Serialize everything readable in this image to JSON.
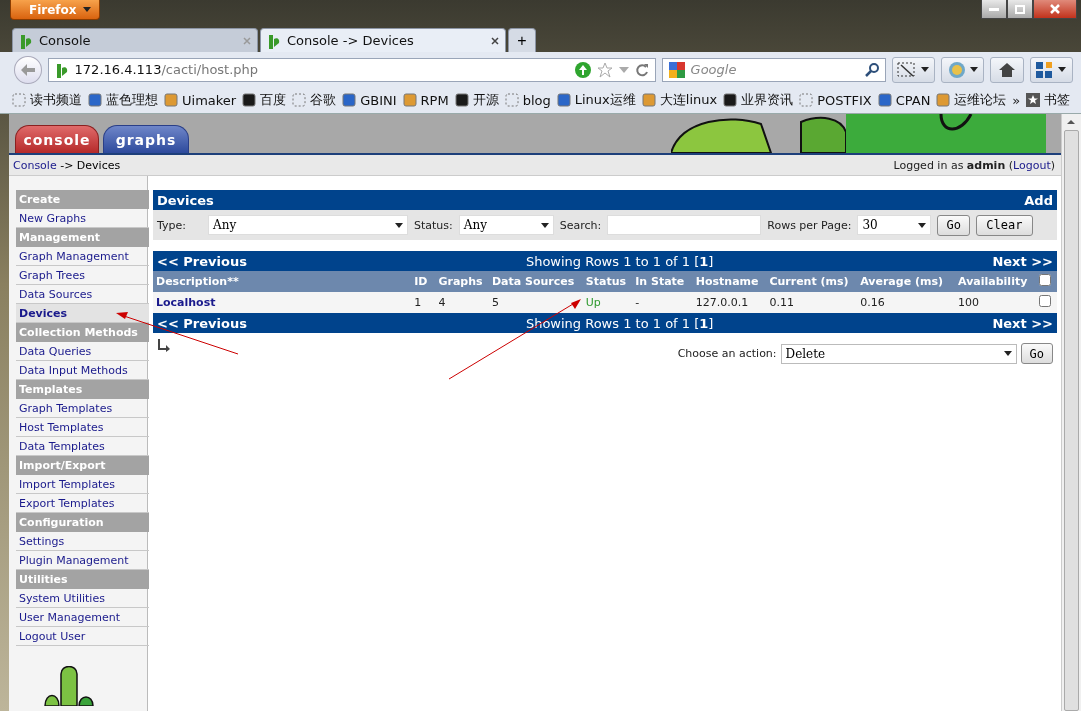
{
  "browser": {
    "menu_button": "Firefox",
    "tabs": [
      {
        "title": "Console",
        "selected": false
      },
      {
        "title": "Console -> Devices",
        "selected": true
      }
    ],
    "new_tab": "+",
    "url": {
      "host": "172.16.4.113",
      "path": "/cacti/host.php"
    },
    "search": {
      "placeholder": "Google"
    },
    "bookmarks": [
      "读书频道",
      "蓝色理想",
      "Uimaker",
      "百度",
      "谷歌",
      "GBINI",
      "RPM",
      "开源",
      "blog",
      "Linux运维",
      "大连linux",
      "业界资讯",
      "POSTFIX",
      "CPAN",
      "运维论坛"
    ],
    "bookmarks_more": "»",
    "bookmarks_folder": "书签"
  },
  "cacti": {
    "top_tabs": [
      {
        "label": "console",
        "selected": true
      },
      {
        "label": "graphs",
        "selected": false
      }
    ],
    "breadcrumb": {
      "link": "Console",
      "rest": "-> Devices"
    },
    "login": {
      "prefix": "Logged in as",
      "user": "admin",
      "open": "(",
      "link": "Logout",
      "close": ")"
    },
    "sidebar": [
      {
        "kind": "header",
        "label": "Create"
      },
      {
        "kind": "item",
        "label": "New Graphs",
        "selected": false
      },
      {
        "kind": "header",
        "label": "Management"
      },
      {
        "kind": "item",
        "label": "Graph Management",
        "selected": false
      },
      {
        "kind": "item",
        "label": "Graph Trees",
        "selected": false
      },
      {
        "kind": "item",
        "label": "Data Sources",
        "selected": false
      },
      {
        "kind": "item",
        "label": "Devices",
        "selected": true
      },
      {
        "kind": "header",
        "label": "Collection Methods"
      },
      {
        "kind": "item",
        "label": "Data Queries",
        "selected": false
      },
      {
        "kind": "item",
        "label": "Data Input Methods",
        "selected": false
      },
      {
        "kind": "header",
        "label": "Templates"
      },
      {
        "kind": "item",
        "label": "Graph Templates",
        "selected": false
      },
      {
        "kind": "item",
        "label": "Host Templates",
        "selected": false
      },
      {
        "kind": "item",
        "label": "Data Templates",
        "selected": false
      },
      {
        "kind": "header",
        "label": "Import/Export"
      },
      {
        "kind": "item",
        "label": "Import Templates",
        "selected": false
      },
      {
        "kind": "item",
        "label": "Export Templates",
        "selected": false
      },
      {
        "kind": "header",
        "label": "Configuration"
      },
      {
        "kind": "item",
        "label": "Settings",
        "selected": false
      },
      {
        "kind": "item",
        "label": "Plugin Management",
        "selected": false
      },
      {
        "kind": "header",
        "label": "Utilities"
      },
      {
        "kind": "item",
        "label": "System Utilities",
        "selected": false
      },
      {
        "kind": "item",
        "label": "User Management",
        "selected": false
      },
      {
        "kind": "item",
        "label": "Logout User",
        "selected": false
      }
    ],
    "devices": {
      "title": "Devices",
      "add": "Add",
      "filters": {
        "type_label": "Type:",
        "type_value": "Any",
        "status_label": "Status:",
        "status_value": "Any",
        "search_label": "Search:",
        "rows_label": "Rows per Page:",
        "rows_value": "30",
        "go": "Go",
        "clear": "Clear"
      },
      "pagers": [
        {
          "previous": "<< Previous",
          "showing": "Showing Rows 1 to 1 of 1 [**1**]",
          "next": "Next >>"
        },
        {
          "previous": "<< Previous",
          "showing": "Showing Rows 1 to 1 of 1 [**1**]",
          "next": "Next >>"
        }
      ],
      "columns": [
        "Description**",
        "ID",
        "Graphs",
        "Data Sources",
        "Status",
        "In State",
        "Hostname",
        "Current (ms)",
        "Average (ms)",
        "Availability"
      ],
      "select_all_checked": false,
      "rows": [
        {
          "cells": [
            "Localhost",
            "1",
            "4",
            "5",
            "Up",
            "-",
            "127.0.0.1",
            "0.11",
            "0.16",
            "100"
          ],
          "checked": false
        }
      ],
      "action": {
        "label": "Choose an action:",
        "value": "Delete",
        "go": "Go"
      }
    }
  }
}
